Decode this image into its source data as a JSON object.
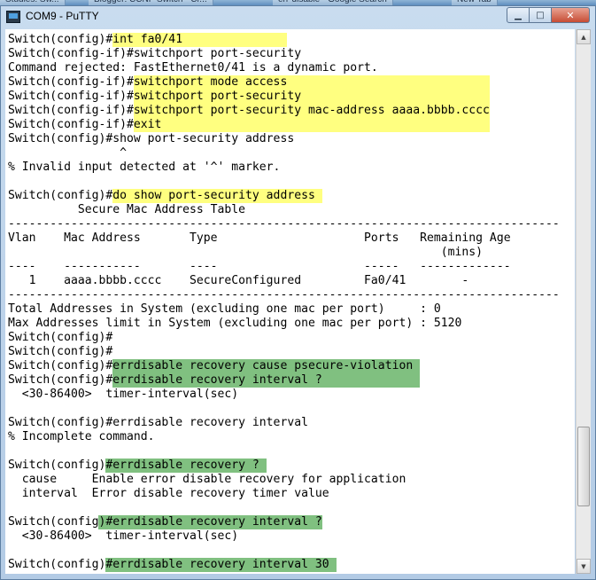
{
  "taskbar": {
    "tabs": [
      "Studies: Sw...",
      "Blogger: CCNP Switch - Cr...",
      "err-disable - Google Search",
      "New Tab"
    ]
  },
  "window": {
    "title": "COM9 - PuTTY",
    "icon": "putty-icon",
    "minimize_glyph": "▁",
    "maximize_glyph": "□",
    "close_glyph": "✕"
  },
  "colors": {
    "highlight_yellow": "#ffff80",
    "highlight_green": "#80c080",
    "terminal_background": "#ffffff",
    "terminal_text": "#000000"
  },
  "terminal": {
    "lines": [
      "Switch(config)#int fa0/41",
      "Switch(config-if)#switchport port-security",
      "Command rejected: FastEthernet0/41 is a dynamic port.",
      "Switch(config-if)#switchport mode access",
      "Switch(config-if)#switchport port-security",
      "Switch(config-if)#switchport port-security mac-address aaaa.bbbb.cccc",
      "Switch(config-if)#exit",
      "Switch(config)#show port-security address",
      "                ^",
      "% Invalid input detected at '^' marker.",
      "",
      "Switch(config)#do show port-security address",
      "          Secure Mac Address Table",
      "-------------------------------------------------------------------------------",
      "Vlan    Mac Address       Type                     Ports   Remaining Age",
      "                                                              (mins)",
      "----    -----------       ----                     -----   -------------",
      "   1    aaaa.bbbb.cccc    SecureConfigured         Fa0/41        -",
      "-------------------------------------------------------------------------------",
      "Total Addresses in System (excluding one mac per port)     : 0",
      "Max Addresses limit in System (excluding one mac per port) : 5120",
      "Switch(config)#",
      "Switch(config)#",
      "Switch(config)#errdisable recovery cause psecure-violation",
      "Switch(config)#errdisable recovery interval ?",
      "  <30-86400>  timer-interval(sec)",
      "",
      "Switch(config)#errdisable recovery interval",
      "% Incomplete command.",
      "",
      "Switch(config)#errdisable recovery ?",
      "  cause     Enable error disable recovery for application",
      "  interval  Error disable recovery timer value",
      "",
      "Switch(config)#errdisable recovery interval ?",
      "  <30-86400>  timer-interval(sec)",
      "",
      "Switch(config)#errdisable recovery interval 30"
    ],
    "highlights": [
      {
        "line": 0,
        "start": 15,
        "end": 40,
        "color": "yellow"
      },
      {
        "line": 3,
        "start": 18,
        "end": 69,
        "color": "yellow"
      },
      {
        "line": 4,
        "start": 18,
        "end": 69,
        "color": "yellow"
      },
      {
        "line": 5,
        "start": 18,
        "end": 69,
        "color": "yellow"
      },
      {
        "line": 6,
        "start": 18,
        "end": 69,
        "color": "yellow"
      },
      {
        "line": 11,
        "start": 15,
        "end": 45,
        "color": "yellow"
      },
      {
        "line": 23,
        "start": 15,
        "end": 59,
        "color": "green"
      },
      {
        "line": 24,
        "start": 15,
        "end": 59,
        "color": "green"
      },
      {
        "line": 30,
        "start": 14,
        "end": 37,
        "color": "green"
      },
      {
        "line": 34,
        "start": 13,
        "end": 45,
        "color": "green"
      },
      {
        "line": 37,
        "start": 14,
        "end": 47,
        "color": "green"
      }
    ]
  },
  "scrollbar": {
    "up_glyph": "▲",
    "down_glyph": "▼",
    "thumb_position_fraction": 0.88
  }
}
